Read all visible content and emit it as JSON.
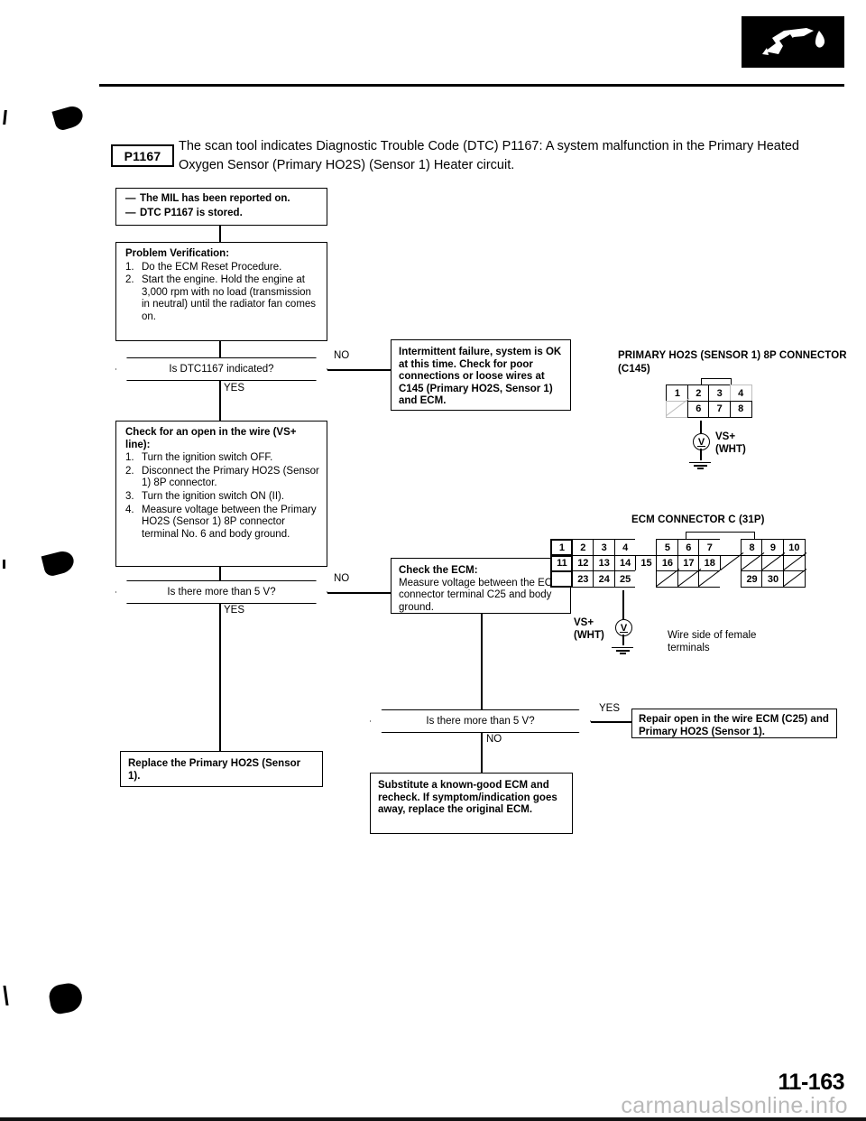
{
  "document": {
    "page_number": "11-163",
    "watermark": "carmanualsonline.info",
    "logo_icon": "fuel-nozzle-icon"
  },
  "intro": {
    "dtc_code": "P1167",
    "description": "The scan tool indicates Diagnostic Trouble Code (DTC) P1167: A system malfunction in the Primary Heated Oxygen Sensor (Primary HO2S) (Sensor 1) Heater circuit."
  },
  "flow": {
    "symptom_box": {
      "items": [
        "The MIL has been reported on.",
        "DTC P1167 is stored."
      ]
    },
    "problem_verification": {
      "title": "Problem Verification:",
      "steps": [
        {
          "num": "1.",
          "text": "Do the ECM Reset Procedure."
        },
        {
          "num": "2.",
          "text": "Start the engine. Hold the engine at 3,000 rpm with no load (transmission in neutral) until the radiator fan comes on."
        }
      ]
    },
    "decision_1": {
      "question": "Is DTC1167 indicated?",
      "yes_label": "YES",
      "no_label": "NO"
    },
    "intermittent_box": {
      "text": "Intermittent failure, system is OK at this time. Check for poor connections or loose wires at C145 (Primary HO2S, Sensor 1) and ECM."
    },
    "check_open_wire": {
      "title": "Check for an open in the wire (VS+ line):",
      "steps": [
        {
          "num": "1.",
          "text": "Turn the ignition switch OFF."
        },
        {
          "num": "2.",
          "text": "Disconnect the Primary HO2S (Sensor 1) 8P connector."
        },
        {
          "num": "3.",
          "text": "Turn the ignition switch ON (II)."
        },
        {
          "num": "4.",
          "text": "Measure voltage between the Primary HO2S (Sensor 1) 8P connector terminal No. 6 and body ground."
        }
      ]
    },
    "decision_2": {
      "question": "Is there more than 5 V?",
      "yes_label": "YES",
      "no_label": "NO"
    },
    "check_ecm": {
      "title": "Check the ECM:",
      "text": "Measure voltage between the ECM connector terminal C25 and body ground."
    },
    "decision_3": {
      "question": "Is there more than 5 V?",
      "yes_label": "YES",
      "no_label": "NO"
    },
    "repair_open_box": {
      "text": "Repair open in the wire ECM (C25) and Primary HO2S (Sensor 1)."
    },
    "substitute_ecm_box": {
      "text": "Substitute a known-good ECM and recheck. If symptom/indication goes away, replace the original ECM."
    },
    "replace_sensor_box": {
      "text": "Replace the Primary HO2S (Sensor 1)."
    }
  },
  "connector_8p": {
    "title": "PRIMARY HO2S (SENSOR 1) 8P CONNECTOR",
    "subtitle": "(C145)",
    "row_top": [
      "1",
      "2",
      "3",
      "4"
    ],
    "row_bottom": [
      "",
      "6",
      "7",
      "8"
    ],
    "probe_label": "VS+",
    "probe_wire_color": "(WHT)",
    "meter_symbol": "V"
  },
  "connector_ecm": {
    "title": "ECM CONNECTOR C (31P)",
    "row_1": [
      "1",
      "2",
      "3",
      "4",
      "",
      "5",
      "6",
      "7",
      "",
      "8",
      "9",
      "10"
    ],
    "row_2": [
      "11",
      "12",
      "13",
      "14",
      "15",
      "16",
      "17",
      "18",
      "",
      "",
      "",
      ""
    ],
    "row_3": [
      "",
      "23",
      "24",
      "25",
      "",
      "",
      "",
      "",
      "",
      "29",
      "30",
      ""
    ],
    "probe_label": "VS+",
    "probe_wire_color": "(WHT)",
    "meter_symbol": "V",
    "note": "Wire side of female terminals"
  }
}
